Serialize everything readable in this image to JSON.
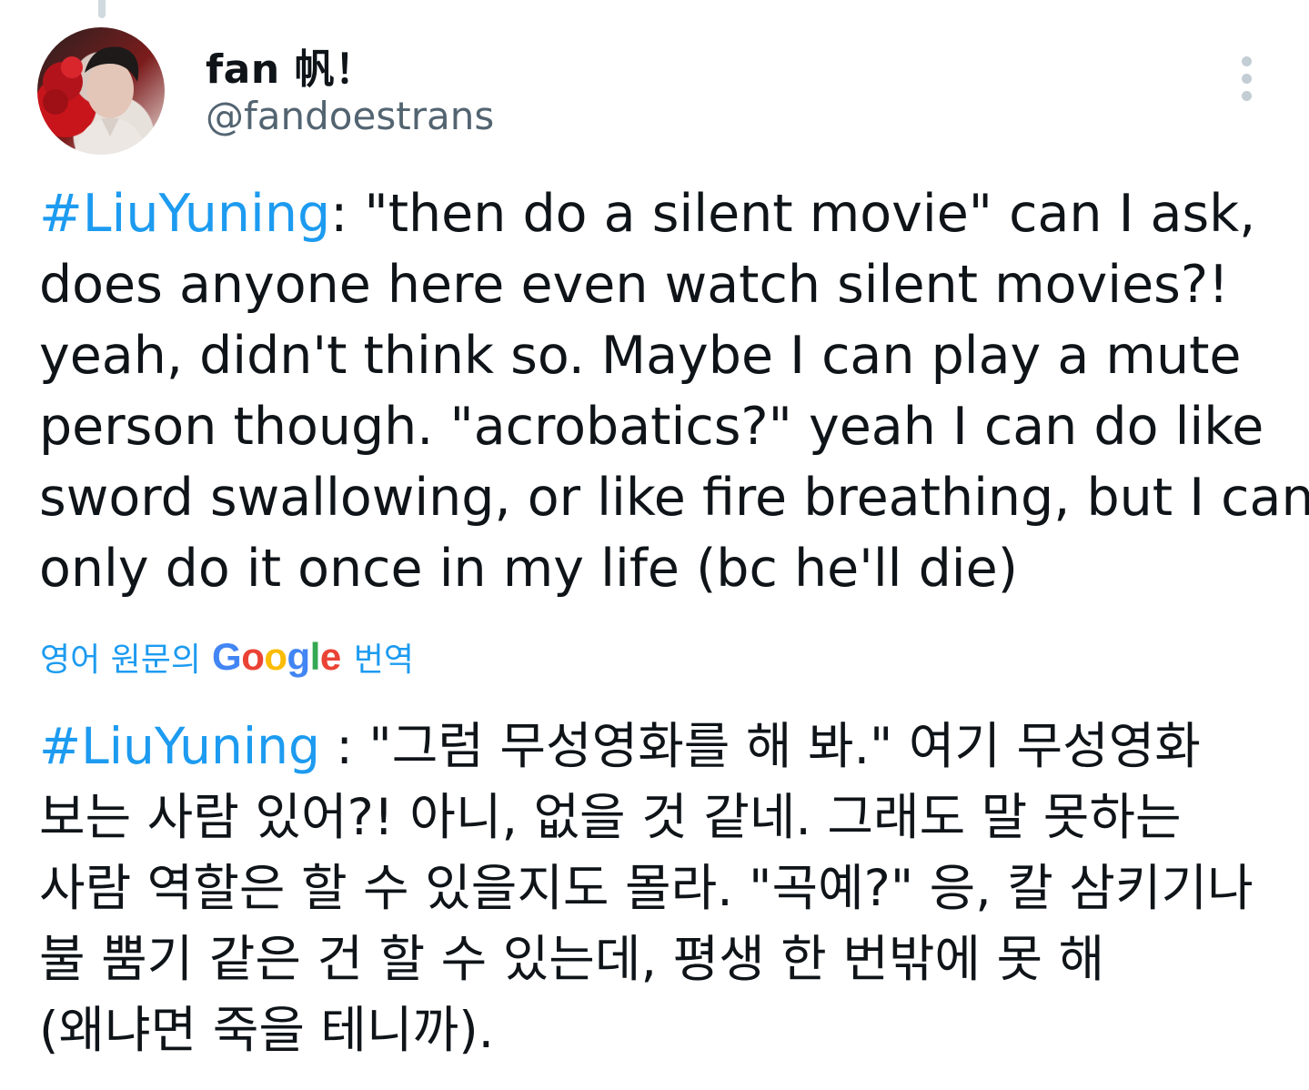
{
  "author": {
    "display_name": "fan 帆！",
    "handle": "@fandoestrans"
  },
  "tweet": {
    "hashtag": "#LiuYuning",
    "lines": [
      ": \"then do a silent movie\" can I ask,",
      "does anyone here even watch silent movies?!",
      "yeah, didn't think so. Maybe I can play a mute",
      "person though. \"acrobatics?\" yeah I can do like",
      "sword swallowing, or like fire breathing, but I can",
      "only do it once in my life (bc he'll die)"
    ]
  },
  "translation": {
    "prefix": "영어 원문의",
    "google_letters": [
      {
        "ch": "G",
        "color": "#4285F4"
      },
      {
        "ch": "o",
        "color": "#EA4335"
      },
      {
        "ch": "o",
        "color": "#FBBC05"
      },
      {
        "ch": "g",
        "color": "#4285F4"
      },
      {
        "ch": "l",
        "color": "#34A853"
      },
      {
        "ch": "e",
        "color": "#EA4335"
      }
    ],
    "suffix": "번역",
    "hashtag": "#LiuYuning",
    "lines": [
      " : \"그럼 무성영화를 해 봐.\" 여기 무성영화",
      "보는 사람 있어?! 아니, 없을 것 같네. 그래도 말 못하는",
      "사람 역할은 할 수 있을지도 몰라. \"곡예?\" 응, 칼 삼키기나",
      "불 뿜기 같은 건 할 수 있는데, 평생 한 번밖에 못 해",
      "(왜냐면 죽을 테니까)."
    ]
  },
  "colors": {
    "link": "#1d9bf0",
    "text": "#0f1419",
    "secondary": "#536471"
  },
  "icons": {
    "more": "more-vertical-icon",
    "avatar": "profile-photo"
  }
}
